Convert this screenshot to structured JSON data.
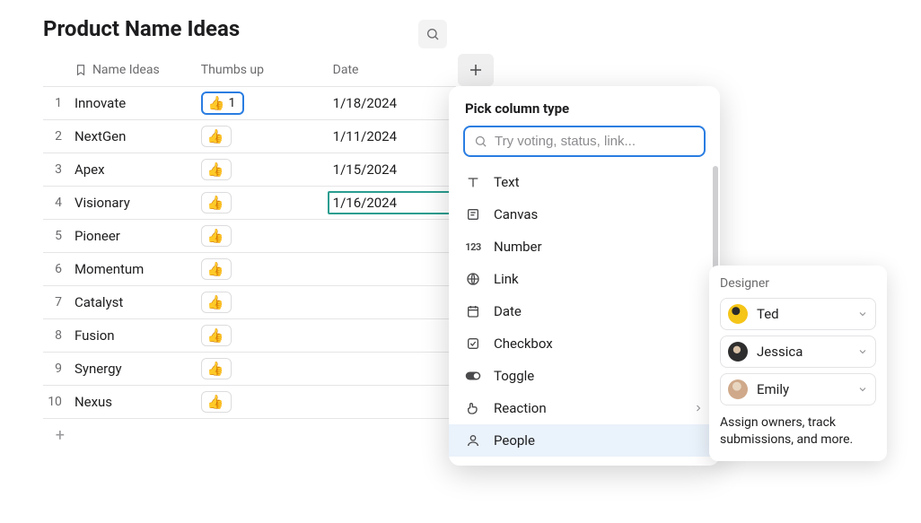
{
  "title": "Product Name Ideas",
  "columns": {
    "name": "Name Ideas",
    "thumbs": "Thumbs up",
    "date": "Date"
  },
  "rows": [
    {
      "n": "1",
      "name": "Innovate",
      "thumbs_count": "1",
      "date": "1/18/2024",
      "thumb_selected": true
    },
    {
      "n": "2",
      "name": "NextGen",
      "date": "1/11/2024"
    },
    {
      "n": "3",
      "name": "Apex",
      "date": "1/15/2024"
    },
    {
      "n": "4",
      "name": "Visionary",
      "date": "1/16/2024",
      "date_selected": true
    },
    {
      "n": "5",
      "name": "Pioneer"
    },
    {
      "n": "6",
      "name": "Momentum"
    },
    {
      "n": "7",
      "name": "Catalyst"
    },
    {
      "n": "8",
      "name": "Fusion"
    },
    {
      "n": "9",
      "name": "Synergy"
    },
    {
      "n": "10",
      "name": "Nexus"
    }
  ],
  "popover": {
    "title": "Pick column type",
    "placeholder": "Try voting, status, link...",
    "items": [
      {
        "label": "Text",
        "icon": "text"
      },
      {
        "label": "Canvas",
        "icon": "canvas"
      },
      {
        "label": "Number",
        "icon": "number"
      },
      {
        "label": "Link",
        "icon": "link"
      },
      {
        "label": "Date",
        "icon": "date"
      },
      {
        "label": "Checkbox",
        "icon": "checkbox"
      },
      {
        "label": "Toggle",
        "icon": "toggle"
      },
      {
        "label": "Reaction",
        "icon": "reaction",
        "submenu": true
      },
      {
        "label": "People",
        "icon": "people",
        "active": true
      }
    ]
  },
  "designer": {
    "title": "Designer",
    "people": [
      {
        "name": "Ted",
        "color": "#f5c518"
      },
      {
        "name": "Jessica",
        "color": "#3a3a3a"
      },
      {
        "name": "Emily",
        "color": "#d9b8a3"
      }
    ],
    "desc": "Assign owners, track submissions, and more."
  }
}
